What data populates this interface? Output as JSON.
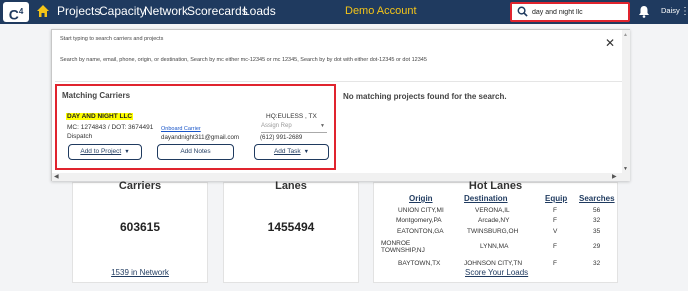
{
  "nav": {
    "logo": "C",
    "logo_sup": "4",
    "items": [
      "Projects",
      "Capacity",
      "Network",
      "Scorecards",
      "Loads"
    ],
    "demo_label": "Demo Account",
    "search_value": "day and night llc",
    "user": "Daisy",
    "kebab": "⋮"
  },
  "panel": {
    "hint1": "Start typing to search carriers and projects",
    "hint2": "Search by name, email, phone, origin, or destination, Search by mc either mc-12345 or mc 12345, Search by by dot with either dot-12345 or dot 12345",
    "close": "✕",
    "matching_title": "Matching Carriers",
    "no_projects": "No matching projects found for the search.",
    "carrier": {
      "name": "DAY AND NIGHT LLC",
      "mc_dot": "MC: 1274843 / DOT: 3674491",
      "onboard": "Onboard Carrier",
      "hq": "HQ:EULESS , TX",
      "assign": "Assign Rep",
      "dispatch": "Dispatch",
      "email": "dayandnight311@gmail.com",
      "phone": "(612) 991-2689"
    },
    "buttons": {
      "add_project": "Add to Project",
      "add_notes": "Add Notes",
      "add_task": "Add Task"
    }
  },
  "cards": {
    "carriers": {
      "title": "Carriers",
      "value": "603615",
      "link": "1539 in Network"
    },
    "lanes": {
      "title": "Lanes",
      "value": "1455494"
    },
    "hot_lanes": {
      "title": "Hot Lanes",
      "headers": [
        "Origin",
        "Destination",
        "Equip",
        "Searches"
      ],
      "rows": [
        [
          "UNION CITY,MI",
          "VERONA,IL",
          "F",
          "56"
        ],
        [
          "Montgomery,PA",
          "Arcade,NY",
          "F",
          "32"
        ],
        [
          "EATONTON,GA",
          "TWINSBURG,OH",
          "V",
          "35"
        ],
        [
          "MONROE TOWNSHIP,NJ",
          "LYNN,MA",
          "F",
          "29"
        ],
        [
          "BAYTOWN,TX",
          "JOHNSON CITY,TN",
          "F",
          "32"
        ]
      ],
      "link": "Score Your Loads"
    }
  },
  "colors": {
    "navbar": "#1f3a5f",
    "accent": "#f5c518",
    "highlight": "#e0242e"
  }
}
